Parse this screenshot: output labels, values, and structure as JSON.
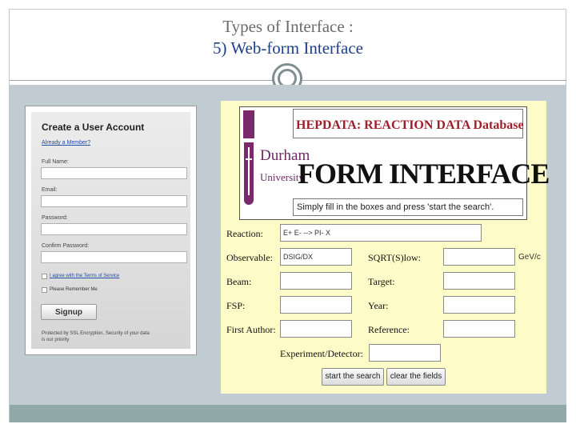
{
  "slide": {
    "title_line1": "Types of Interface :",
    "title_line2": "5) Web-form Interface"
  },
  "signup": {
    "heading": "Create a User Account",
    "member_link": "Already a Member?",
    "fields": {
      "full_name": "Full Name:",
      "email": "Email:",
      "password": "Password:",
      "confirm_password": "Confirm Password:"
    },
    "agree_label": "I agree with the Terms of Service",
    "remember_label": "Please Remember Me",
    "signup_label": "Signup",
    "security_note": "Protected by SSL Encryption, Security of your data is our priority"
  },
  "hepdata": {
    "banner_heading": "HEPDATA: REACTION DATA Database",
    "banner_title": "FORM INTERFACE",
    "university_line1": "Durham",
    "university_line2": "University",
    "instructions": "Simply fill in the boxes and press 'start the search'.",
    "labels": {
      "reaction": "Reaction:",
      "observable": "Observable:",
      "sqrts_low": "SQRT(S)low:",
      "beam": "Beam:",
      "target": "Target:",
      "fsp": "FSP:",
      "year": "Year:",
      "first_author": "First Author:",
      "reference": "Reference:",
      "experiment": "Experiment/Detector:"
    },
    "values": {
      "reaction": "E+ E- --> PI- X",
      "observable": "DSIG/DX",
      "sqrts_unit": "GeV/c"
    },
    "buttons": {
      "start": "start the search",
      "clear": "clear the fields"
    }
  },
  "colors": {
    "title_accent": "#1f3f8a",
    "panel_background": "#c1ccd2",
    "form_background": "#fdfcc8",
    "durham_purple": "#7a2a6b",
    "banner_red": "#9e1f2b"
  }
}
